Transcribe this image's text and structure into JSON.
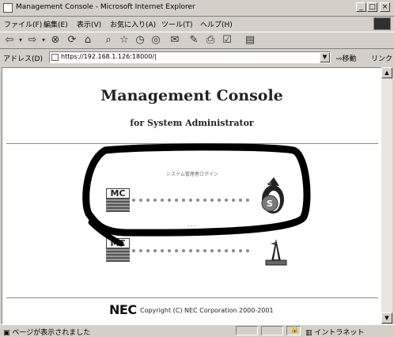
{
  "window": {
    "title": "Management Console - Microsoft Internet Explorer",
    "min_label": "_",
    "max_label": "□",
    "close_label": "×"
  },
  "menubar": {
    "items": [
      "ファイル(F)",
      "編集(E)",
      "表示(V)",
      "お気に入り(A)",
      "ツール(T)",
      "ヘルプ(H)"
    ]
  },
  "toolbar": {
    "buttons": [
      "back-icon",
      "forward-icon",
      "stop-icon",
      "refresh-icon",
      "home-icon",
      "search-icon",
      "favorites-icon",
      "history-icon",
      "mail-icon",
      "edit-icon",
      "print-icon",
      "discuss-icon",
      "messenger-icon"
    ]
  },
  "address": {
    "label": "アドレス(D)",
    "url": "https://192.168.1.126:18000/|",
    "go_label": "移動",
    "links_label": "リンク »"
  },
  "page": {
    "title": "Management Console",
    "subtitle": "for System Administrator",
    "login_label": "システム管理者ログイン",
    "second_label": "- - -",
    "mc_logo_text": "MC",
    "footer_brand": "NEC",
    "footer_copyright": "Copyright (C) NEC Corporation 2000-2001"
  },
  "status": {
    "text": "ページが表示されました",
    "zone": "イントラネット"
  },
  "colors": {
    "annotation_stroke": "#000000",
    "chrome": "#d4d0c8",
    "dot": "#8a8a8a"
  }
}
